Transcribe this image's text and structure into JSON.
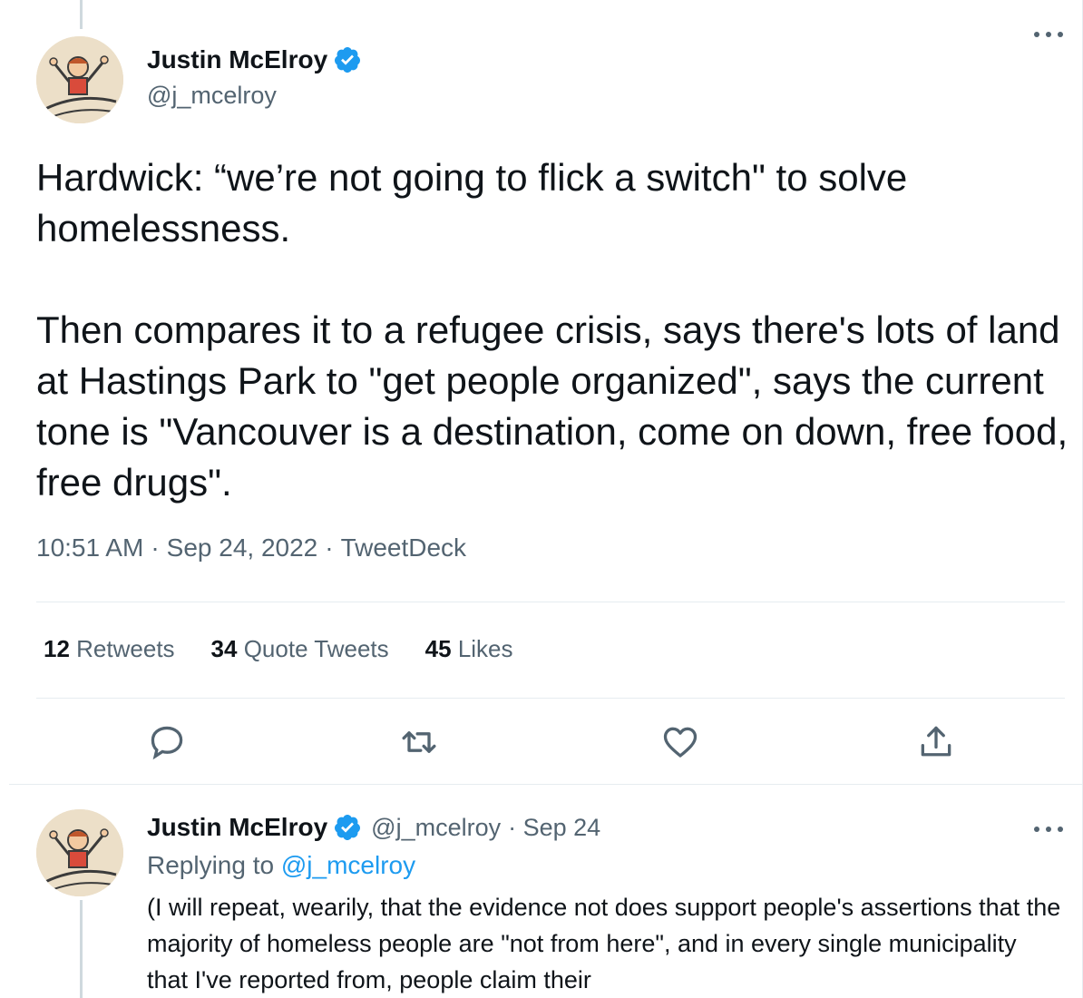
{
  "tweet": {
    "author": {
      "display_name": "Justin McElroy",
      "handle": "@j_mcelroy",
      "verified": true
    },
    "paragraphs": [
      "Hardwick: “we’re not going to flick a switch\" to solve homelessness.",
      "Then compares it to a refugee crisis, says there's lots of land at Hastings Park to \"get people organized\", says the current tone is \"Vancouver is a destination, come on down, free food, free drugs\"."
    ],
    "time": "10:51 AM",
    "date": "Sep 24, 2022",
    "source": "TweetDeck",
    "separator": "·",
    "stats": [
      {
        "count": "12",
        "label": "Retweets"
      },
      {
        "count": "34",
        "label": "Quote Tweets"
      },
      {
        "count": "45",
        "label": "Likes"
      }
    ],
    "actions": [
      "reply-icon",
      "retweet-icon",
      "like-icon",
      "share-icon"
    ]
  },
  "reply": {
    "author": {
      "display_name": "Justin McElroy",
      "handle": "@j_mcelroy",
      "verified": true
    },
    "date_meta": "· Sep 24",
    "replying_prefix": "Replying to",
    "replying_to": "@j_mcelroy",
    "text": "(I will repeat, wearily, that the evidence not does support people's assertions that the majority of homeless people are \"not from here\", and in every single municipality that I've reported from, people claim their"
  },
  "colors": {
    "accent": "#1d9bf0",
    "text": "#0f1419",
    "muted": "#536471",
    "divider": "#e6ecf0"
  }
}
